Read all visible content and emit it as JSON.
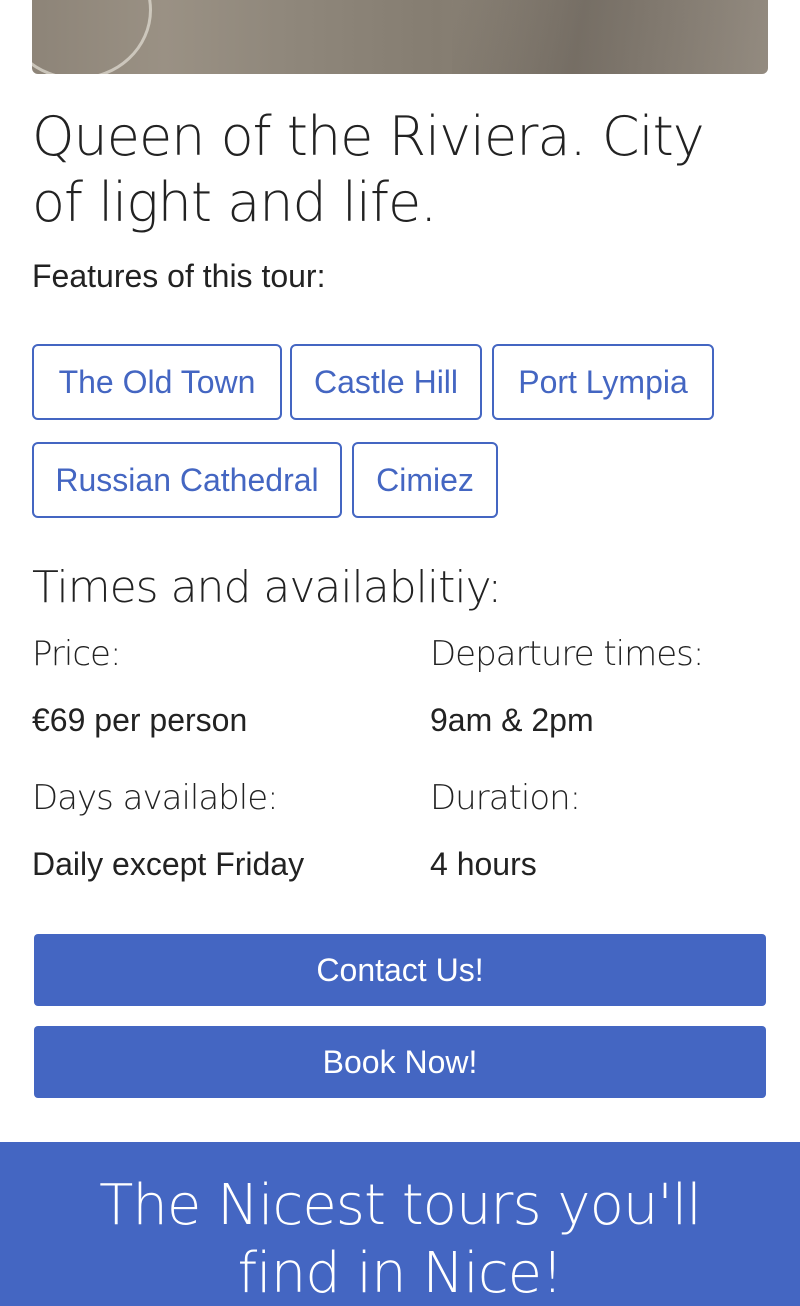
{
  "hero": {
    "image_alt": "street-photo"
  },
  "tour": {
    "heading": "Queen of the Riviera. City of light and life.",
    "features_label": "Features of this tour:",
    "features": [
      "The Old Town",
      "Castle Hill",
      "Port Lympia",
      "Russian Cathedral",
      "Cimiez"
    ]
  },
  "availability": {
    "heading": "Times and availablitiy:",
    "price_label": "Price:",
    "price_value": "€69 per person",
    "departure_label": "Departure times:",
    "departure_value": "9am & 2pm",
    "days_label": "Days available:",
    "days_value": "Daily except Friday",
    "duration_label": "Duration:",
    "duration_value": "4 hours"
  },
  "actions": {
    "contact_label": "Contact Us!",
    "book_label": "Book Now!"
  },
  "footer": {
    "tagline": "The Nicest tours you'll find in Nice!"
  },
  "colors": {
    "accent": "#4466c2",
    "text": "#222222",
    "background": "#ffffff"
  }
}
